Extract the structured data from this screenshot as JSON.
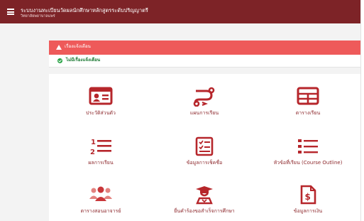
{
  "header": {
    "title": "ระบบงานทะเบียนวัดผลนักศึกษาหลักสูตรระดับปริญญาตรี",
    "subtitle": "วิทยาลัยพยาบาลแพร่"
  },
  "alert": {
    "heading": "เรื่องแจ้งเตือน",
    "message": "ไม่มีเรื่องแจ้งเตือน"
  },
  "colors": {
    "brand": "#7d2327",
    "alert": "#ee5a5a",
    "success": "#27a344",
    "tile_text": "#8e2a2e"
  },
  "menu": [
    {
      "label": "ประวัติส่วนตัว",
      "icon": "id-card-icon"
    },
    {
      "label": "แผนการเรียน",
      "icon": "route-icon"
    },
    {
      "label": "ตารางเรียน",
      "icon": "table-icon"
    },
    {
      "label": "ผลการเรียน",
      "icon": "numbered-list-icon"
    },
    {
      "label": "ข้อมูลการเช็คชื่อ",
      "icon": "checklist-icon"
    },
    {
      "label": "หัวข้อที่เรียน (Course Outline)",
      "icon": "list-icon"
    },
    {
      "label": "ตารางสอนอาจารย์",
      "icon": "users-icon"
    },
    {
      "label": "ยื่นคำร้องขอสำเร็จการศึกษา",
      "icon": "graduate-icon"
    },
    {
      "label": "ข้อมูลการเงิน",
      "icon": "invoice-icon"
    }
  ]
}
